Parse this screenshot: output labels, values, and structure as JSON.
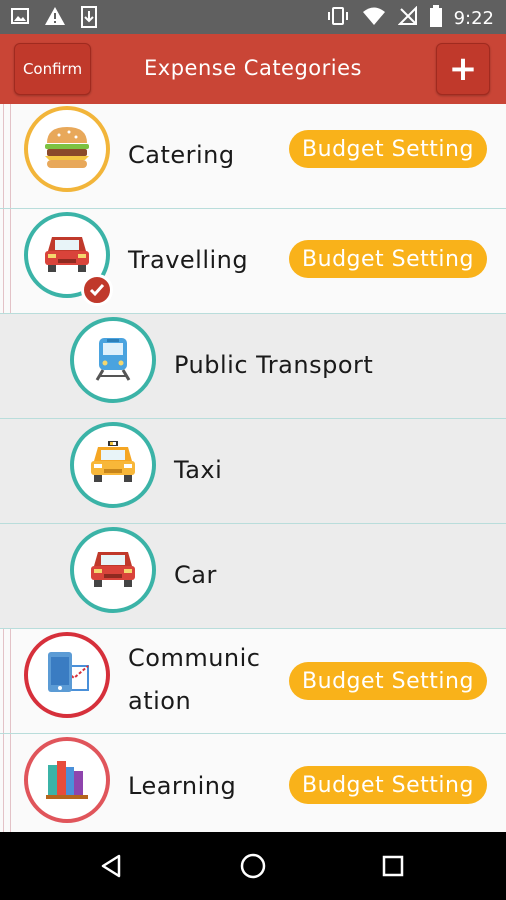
{
  "status_bar": {
    "time": "9:22",
    "left_icons": [
      "image-icon",
      "warning-icon",
      "download-icon"
    ],
    "right_icons": [
      "vibrate-icon",
      "wifi-icon",
      "no-signal-icon",
      "battery-icon"
    ]
  },
  "header": {
    "confirm_label": "Confirm",
    "title": "Expense Categories",
    "add_label": "+"
  },
  "categories": [
    {
      "label": "Catering",
      "icon": "burger-icon",
      "level": "parent",
      "budget_label": "Budget Setting",
      "ring_color": "#f2b53a"
    },
    {
      "label": "Travelling",
      "icon": "car-icon",
      "level": "parent",
      "budget_label": "Budget Setting",
      "ring_color": "#3bb3a7",
      "selected": true
    },
    {
      "label": "Public Transport",
      "icon": "train-icon",
      "level": "child",
      "ring_color": "#3bb3a7"
    },
    {
      "label": "Taxi",
      "icon": "taxi-icon",
      "level": "child",
      "ring_color": "#3bb3a7"
    },
    {
      "label": "Car",
      "icon": "car-icon",
      "level": "child",
      "ring_color": "#3bb3a7"
    },
    {
      "label_line1": "Communic",
      "label_line2": "ation",
      "icon": "phone-mail-icon",
      "level": "parent",
      "budget_label": "Budget Setting",
      "ring_color": "#d6303b"
    },
    {
      "label": "Learning",
      "icon": "books-icon",
      "level": "parent",
      "budget_label": "Budget Setting",
      "ring_color": "#e0555b"
    }
  ],
  "nav_bar": {
    "icons": [
      "back-icon",
      "home-icon",
      "recents-icon"
    ]
  },
  "colors": {
    "app_bar": "#c94536",
    "budget_button": "#f9b21a",
    "status_bar": "#606060"
  }
}
